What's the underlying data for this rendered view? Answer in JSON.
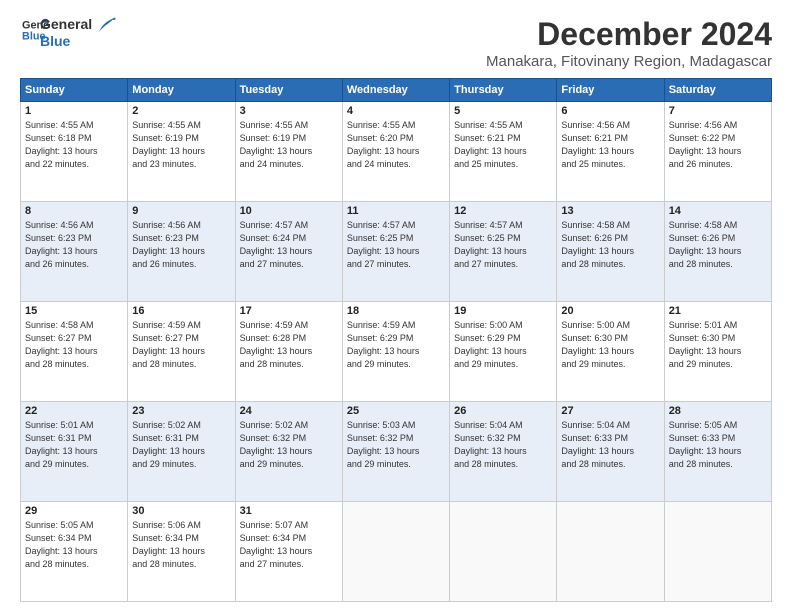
{
  "logo": {
    "line1": "General",
    "line2": "Blue"
  },
  "title": "December 2024",
  "subtitle": "Manakara, Fitovinany Region, Madagascar",
  "weekdays": [
    "Sunday",
    "Monday",
    "Tuesday",
    "Wednesday",
    "Thursday",
    "Friday",
    "Saturday"
  ],
  "weeks": [
    [
      {
        "day": "1",
        "info": "Sunrise: 4:55 AM\nSunset: 6:18 PM\nDaylight: 13 hours\nand 22 minutes."
      },
      {
        "day": "2",
        "info": "Sunrise: 4:55 AM\nSunset: 6:19 PM\nDaylight: 13 hours\nand 23 minutes."
      },
      {
        "day": "3",
        "info": "Sunrise: 4:55 AM\nSunset: 6:19 PM\nDaylight: 13 hours\nand 24 minutes."
      },
      {
        "day": "4",
        "info": "Sunrise: 4:55 AM\nSunset: 6:20 PM\nDaylight: 13 hours\nand 24 minutes."
      },
      {
        "day": "5",
        "info": "Sunrise: 4:55 AM\nSunset: 6:21 PM\nDaylight: 13 hours\nand 25 minutes."
      },
      {
        "day": "6",
        "info": "Sunrise: 4:56 AM\nSunset: 6:21 PM\nDaylight: 13 hours\nand 25 minutes."
      },
      {
        "day": "7",
        "info": "Sunrise: 4:56 AM\nSunset: 6:22 PM\nDaylight: 13 hours\nand 26 minutes."
      }
    ],
    [
      {
        "day": "8",
        "info": "Sunrise: 4:56 AM\nSunset: 6:23 PM\nDaylight: 13 hours\nand 26 minutes."
      },
      {
        "day": "9",
        "info": "Sunrise: 4:56 AM\nSunset: 6:23 PM\nDaylight: 13 hours\nand 26 minutes."
      },
      {
        "day": "10",
        "info": "Sunrise: 4:57 AM\nSunset: 6:24 PM\nDaylight: 13 hours\nand 27 minutes."
      },
      {
        "day": "11",
        "info": "Sunrise: 4:57 AM\nSunset: 6:25 PM\nDaylight: 13 hours\nand 27 minutes."
      },
      {
        "day": "12",
        "info": "Sunrise: 4:57 AM\nSunset: 6:25 PM\nDaylight: 13 hours\nand 27 minutes."
      },
      {
        "day": "13",
        "info": "Sunrise: 4:58 AM\nSunset: 6:26 PM\nDaylight: 13 hours\nand 28 minutes."
      },
      {
        "day": "14",
        "info": "Sunrise: 4:58 AM\nSunset: 6:26 PM\nDaylight: 13 hours\nand 28 minutes."
      }
    ],
    [
      {
        "day": "15",
        "info": "Sunrise: 4:58 AM\nSunset: 6:27 PM\nDaylight: 13 hours\nand 28 minutes."
      },
      {
        "day": "16",
        "info": "Sunrise: 4:59 AM\nSunset: 6:27 PM\nDaylight: 13 hours\nand 28 minutes."
      },
      {
        "day": "17",
        "info": "Sunrise: 4:59 AM\nSunset: 6:28 PM\nDaylight: 13 hours\nand 28 minutes."
      },
      {
        "day": "18",
        "info": "Sunrise: 4:59 AM\nSunset: 6:29 PM\nDaylight: 13 hours\nand 29 minutes."
      },
      {
        "day": "19",
        "info": "Sunrise: 5:00 AM\nSunset: 6:29 PM\nDaylight: 13 hours\nand 29 minutes."
      },
      {
        "day": "20",
        "info": "Sunrise: 5:00 AM\nSunset: 6:30 PM\nDaylight: 13 hours\nand 29 minutes."
      },
      {
        "day": "21",
        "info": "Sunrise: 5:01 AM\nSunset: 6:30 PM\nDaylight: 13 hours\nand 29 minutes."
      }
    ],
    [
      {
        "day": "22",
        "info": "Sunrise: 5:01 AM\nSunset: 6:31 PM\nDaylight: 13 hours\nand 29 minutes."
      },
      {
        "day": "23",
        "info": "Sunrise: 5:02 AM\nSunset: 6:31 PM\nDaylight: 13 hours\nand 29 minutes."
      },
      {
        "day": "24",
        "info": "Sunrise: 5:02 AM\nSunset: 6:32 PM\nDaylight: 13 hours\nand 29 minutes."
      },
      {
        "day": "25",
        "info": "Sunrise: 5:03 AM\nSunset: 6:32 PM\nDaylight: 13 hours\nand 29 minutes."
      },
      {
        "day": "26",
        "info": "Sunrise: 5:04 AM\nSunset: 6:32 PM\nDaylight: 13 hours\nand 28 minutes."
      },
      {
        "day": "27",
        "info": "Sunrise: 5:04 AM\nSunset: 6:33 PM\nDaylight: 13 hours\nand 28 minutes."
      },
      {
        "day": "28",
        "info": "Sunrise: 5:05 AM\nSunset: 6:33 PM\nDaylight: 13 hours\nand 28 minutes."
      }
    ],
    [
      {
        "day": "29",
        "info": "Sunrise: 5:05 AM\nSunset: 6:34 PM\nDaylight: 13 hours\nand 28 minutes."
      },
      {
        "day": "30",
        "info": "Sunrise: 5:06 AM\nSunset: 6:34 PM\nDaylight: 13 hours\nand 28 minutes."
      },
      {
        "day": "31",
        "info": "Sunrise: 5:07 AM\nSunset: 6:34 PM\nDaylight: 13 hours\nand 27 minutes."
      },
      {
        "day": "",
        "info": ""
      },
      {
        "day": "",
        "info": ""
      },
      {
        "day": "",
        "info": ""
      },
      {
        "day": "",
        "info": ""
      }
    ]
  ]
}
